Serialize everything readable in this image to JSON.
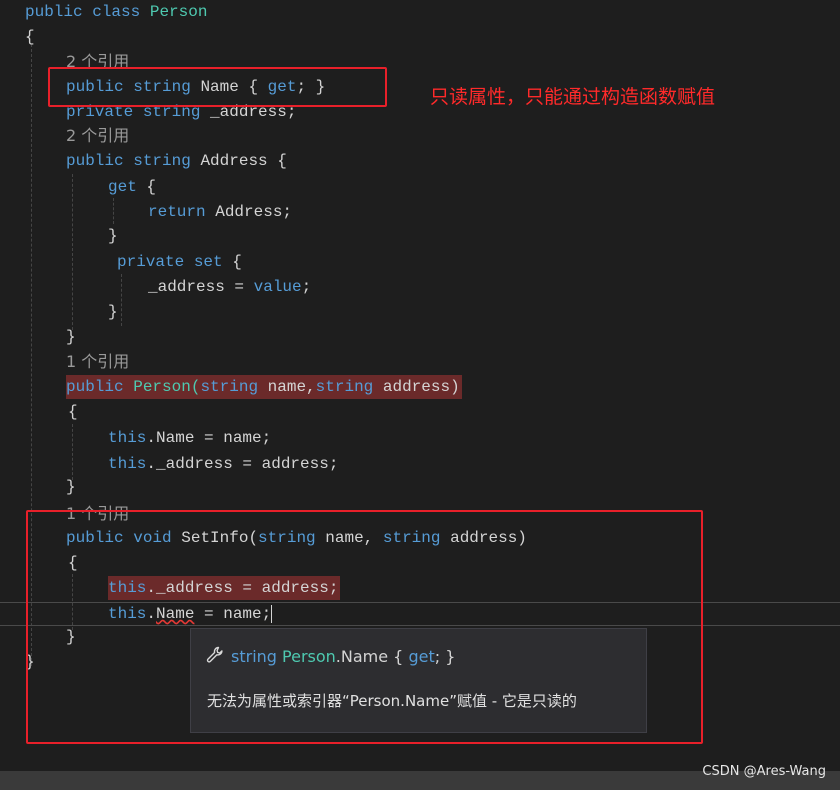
{
  "code": {
    "class_decl": {
      "kw1": "public",
      "kw2": "class",
      "name": "Person"
    },
    "open_brace": "{",
    "close_brace": "}",
    "lens_name": "2 个引用",
    "name_prop": {
      "kw": "public",
      "type": "string",
      "name": "Name",
      "acc_open": "{ ",
      "get": "get",
      "acc_close": "; }"
    },
    "address_field": {
      "kw": "private",
      "type": "string",
      "name": "_address;"
    },
    "lens_address": "2 个引用",
    "address_prop": {
      "kw": "public",
      "type": "string",
      "name": "Address {"
    },
    "getter": {
      "kw": "get",
      "brace": "{"
    },
    "getter_return": {
      "kw": "return",
      "rest": "Address;"
    },
    "getter_close": "}",
    "setter": {
      "kw1": "private",
      "kw2": "set",
      "brace": "{"
    },
    "setter_body": {
      "lhs": "_address = ",
      "kw": "value",
      "end": ";"
    },
    "setter_close": "}",
    "prop_close": "}",
    "lens_ctor": "1 个引用",
    "ctor": {
      "kw": "public",
      "name": "Person(",
      "type1": "string",
      "p1": " name,",
      "type2": "string",
      "p2": " address)"
    },
    "ctor_open": "{",
    "ctor_line1": {
      "kw": "this",
      "rest": ".Name = name;"
    },
    "ctor_line2": {
      "kw": "this",
      "rest": "._address = address;"
    },
    "ctor_close": "}",
    "lens_setinfo": "1 个引用",
    "setinfo": {
      "kw1": "public",
      "kw2": "void",
      "name": "SetInfo(",
      "type1": "string",
      "p1": " name, ",
      "type2": "string",
      "p2": " address)"
    },
    "setinfo_open": "{",
    "setinfo_line1": {
      "kw": "this",
      "rest": "._address = address;"
    },
    "setinfo_line2": {
      "kw": "this",
      "dot": ".",
      "err": "Name",
      "rest": " = name;"
    },
    "setinfo_close": "}",
    "class_close": "}"
  },
  "annotation": "只读属性，只能通过构造函数赋值",
  "tooltip": {
    "icon": "wrench-icon",
    "sig_type": "string",
    "sig_class": "Person",
    "sig_rest": ".Name { ",
    "sig_get": "get",
    "sig_end": "; }",
    "message": "无法为属性或索引器“Person.Name”赋值 - 它是只读的"
  },
  "watermark": "CSDN @Ares-Wang",
  "colors": {
    "keyword": "#569cd6",
    "type": "#4ec9b0",
    "error_box": "#e8202a",
    "annotation": "#ff2a2a"
  }
}
